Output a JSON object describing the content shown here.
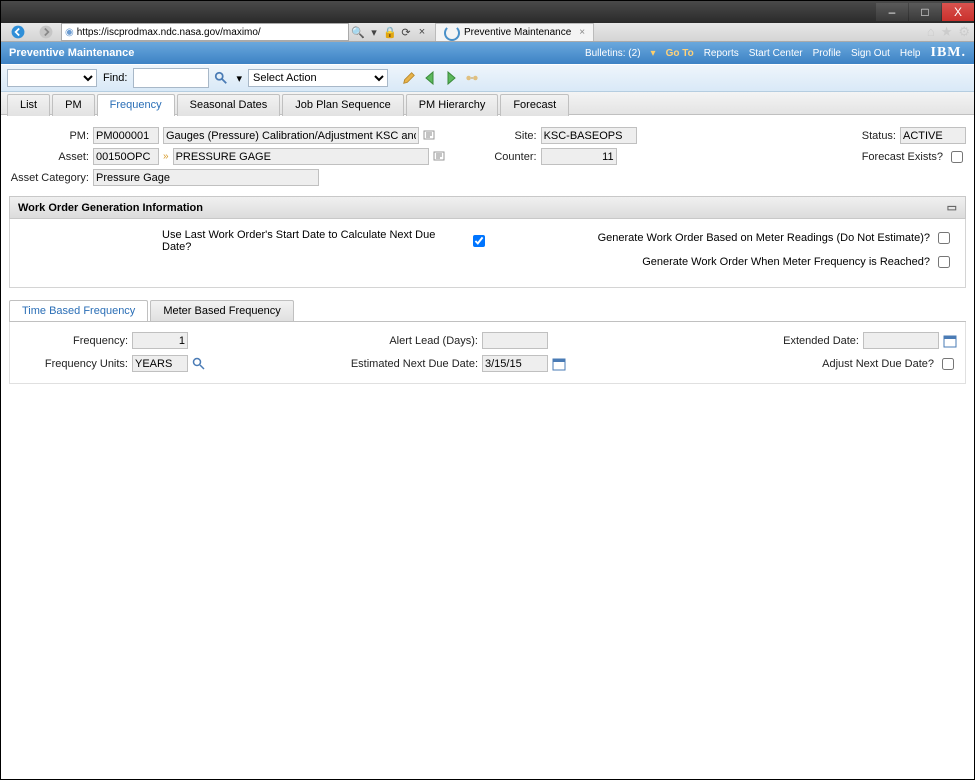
{
  "window": {
    "minimize": "–",
    "maximize": "□",
    "close": "X"
  },
  "browser": {
    "url": "https://iscprodmax.ndc.nasa.gov/maximo/",
    "tab_title": "Preventive Maintenance",
    "tab_close": "×",
    "search_indicator": "🔍 ▾",
    "lock": "🔒",
    "refresh": "⟳",
    "stop": "×"
  },
  "mx": {
    "title": "Preventive Maintenance",
    "bulletins": "Bulletins: (2)",
    "goto": "Go To",
    "reports": "Reports",
    "start_center": "Start Center",
    "profile": "Profile",
    "sign_out": "Sign Out",
    "help": "Help",
    "ibm": "IBM."
  },
  "toolbar": {
    "find_label": "Find:",
    "select_action": "Select Action",
    "search_dropdown": "▾"
  },
  "tabs": {
    "list": "List",
    "pm": "PM",
    "frequency": "Frequency",
    "seasonal": "Seasonal Dates",
    "jobplan": "Job Plan Sequence",
    "pmh": "PM Hierarchy",
    "forecast": "Forecast"
  },
  "fields": {
    "pm_lbl": "PM:",
    "pm_val": "PM000001",
    "pm_desc": "Gauges (Pressure) Calibration/Adjustment KSC and CCAFS",
    "asset_lbl": "Asset:",
    "asset_val": "00150OPC",
    "asset_desc": "PRESSURE GAGE",
    "cat_lbl": "Asset Category:",
    "cat_val": "Pressure Gage",
    "site_lbl": "Site:",
    "site_val": "KSC-BASEOPS",
    "counter_lbl": "Counter:",
    "counter_val": "11",
    "status_lbl": "Status:",
    "status_val": "ACTIVE",
    "forecast_exists_lbl": "Forecast Exists?"
  },
  "wog": {
    "header": "Work Order Generation Information",
    "use_last": "Use Last Work Order's Start Date to Calculate Next Due Date?",
    "meter_est": "Generate Work Order Based on Meter Readings (Do Not Estimate)?",
    "meter_freq": "Generate Work Order When Meter Frequency is Reached?"
  },
  "subtabs": {
    "time": "Time Based Frequency",
    "meter": "Meter Based Frequency"
  },
  "freq": {
    "freq_lbl": "Frequency:",
    "freq_val": "1",
    "units_lbl": "Frequency Units:",
    "units_val": "YEARS",
    "alert_lbl": "Alert Lead (Days):",
    "alert_val": "",
    "estnext_lbl": "Estimated Next Due Date:",
    "estnext_val": "3/15/15",
    "ext_lbl": "Extended Date:",
    "ext_val": "",
    "adj_lbl": "Adjust Next Due Date?"
  }
}
